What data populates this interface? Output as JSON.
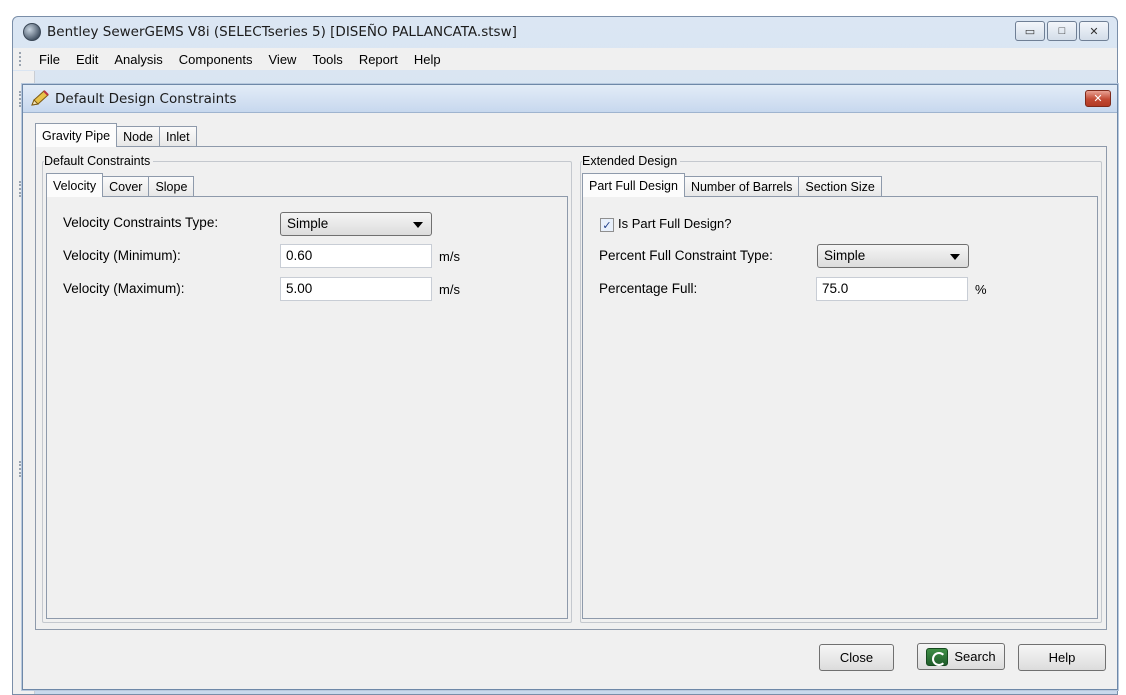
{
  "app": {
    "title": "Bentley SewerGEMS V8i (SELECTseries 5) [DISEÑO PALLANCATA.stsw]",
    "menu": [
      "File",
      "Edit",
      "Analysis",
      "Components",
      "View",
      "Tools",
      "Report",
      "Help"
    ],
    "window_buttons": {
      "minimize": "▭",
      "maximize": "□",
      "close": "✕"
    }
  },
  "dialog": {
    "title": "Default Design Constraints",
    "close_glyph": "✕",
    "top_tabs": [
      "Gravity Pipe",
      "Node",
      "Inlet"
    ],
    "left_group": {
      "label": "Default Constraints",
      "tabs": [
        "Velocity",
        "Cover",
        "Slope"
      ],
      "fields": [
        {
          "label": "Velocity Constraints Type:",
          "value": "Simple",
          "type": "dropdown"
        },
        {
          "label": "Velocity (Minimum):",
          "value": "0.60",
          "unit": "m/s"
        },
        {
          "label": "Velocity (Maximum):",
          "value": "5.00",
          "unit": "m/s"
        }
      ]
    },
    "right_group": {
      "label": "Extended Design",
      "tabs": [
        "Part Full Design",
        "Number of Barrels",
        "Section Size"
      ],
      "checkbox": {
        "label": "Is Part Full Design?",
        "checked": true,
        "mark": "✓"
      },
      "fields": [
        {
          "label": "Percent Full Constraint Type:",
          "value": "Simple",
          "type": "dropdown"
        },
        {
          "label": "Percentage Full:",
          "value": "75.0",
          "unit": "%"
        }
      ]
    },
    "buttons": {
      "close": "Close",
      "search": "Search",
      "help": "Help"
    }
  },
  "colors": {
    "accent": "#c7d8ee",
    "close_red": "#c24a34",
    "window_bg": "#f0f0f0"
  }
}
